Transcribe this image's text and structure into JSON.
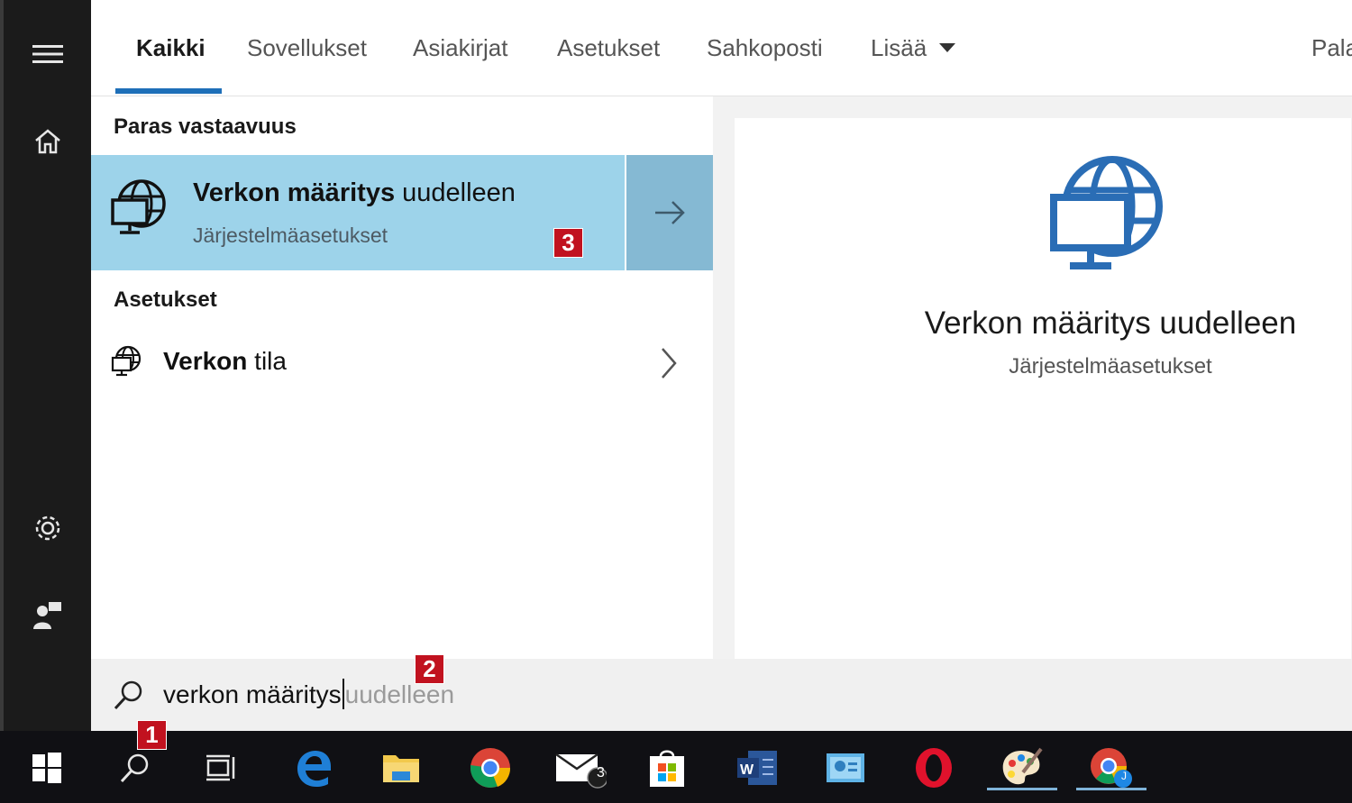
{
  "tabs": [
    {
      "label": "Kaikki",
      "active": true
    },
    {
      "label": "Sovellukset"
    },
    {
      "label": "Asiakirjat"
    },
    {
      "label": "Asetukset"
    },
    {
      "label": "Sahkoposti"
    },
    {
      "label": "Lisää"
    },
    {
      "label": "Pala"
    }
  ],
  "results": {
    "best_heading": "Paras vastaavuus",
    "best_match": {
      "title_bold": "Verkon määritys",
      "title_rest": " uudelleen",
      "subtitle": "Järjestelmäasetukset",
      "icon": "network-globe-icon"
    },
    "settings_heading": "Asetukset",
    "setting_item": {
      "label_bold": "Verkon",
      "label_rest": " tila",
      "icon": "network-globe-icon"
    }
  },
  "preview": {
    "title": "Verkon määritys uudelleen",
    "subtitle": "Järjestelmäasetukset",
    "icon": "network-globe-icon",
    "icon_color": "#2a6db5"
  },
  "search": {
    "typed": "verkon määritys",
    "suggestion": "uudelleen"
  },
  "badges": [
    "1",
    "2",
    "3"
  ],
  "rail_icons": [
    "hamburger-icon",
    "home-icon",
    "settings-gear-icon",
    "feedback-person-icon"
  ],
  "taskbar_icons": [
    "windows-start-icon",
    "search-icon",
    "task-view-icon",
    "edge-icon",
    "file-explorer-icon",
    "chrome-icon",
    "mail-icon",
    "store-icon",
    "word-icon",
    "control-panel-icon",
    "opera-icon",
    "paint-icon",
    "chrome-profile-icon"
  ],
  "taskbar": {
    "mail_count": "3",
    "profile_initial": "J"
  },
  "colors": {
    "accent": "#1e6fb8",
    "best_match_bg": "#9dd3ea",
    "badge": "#c1121f"
  }
}
